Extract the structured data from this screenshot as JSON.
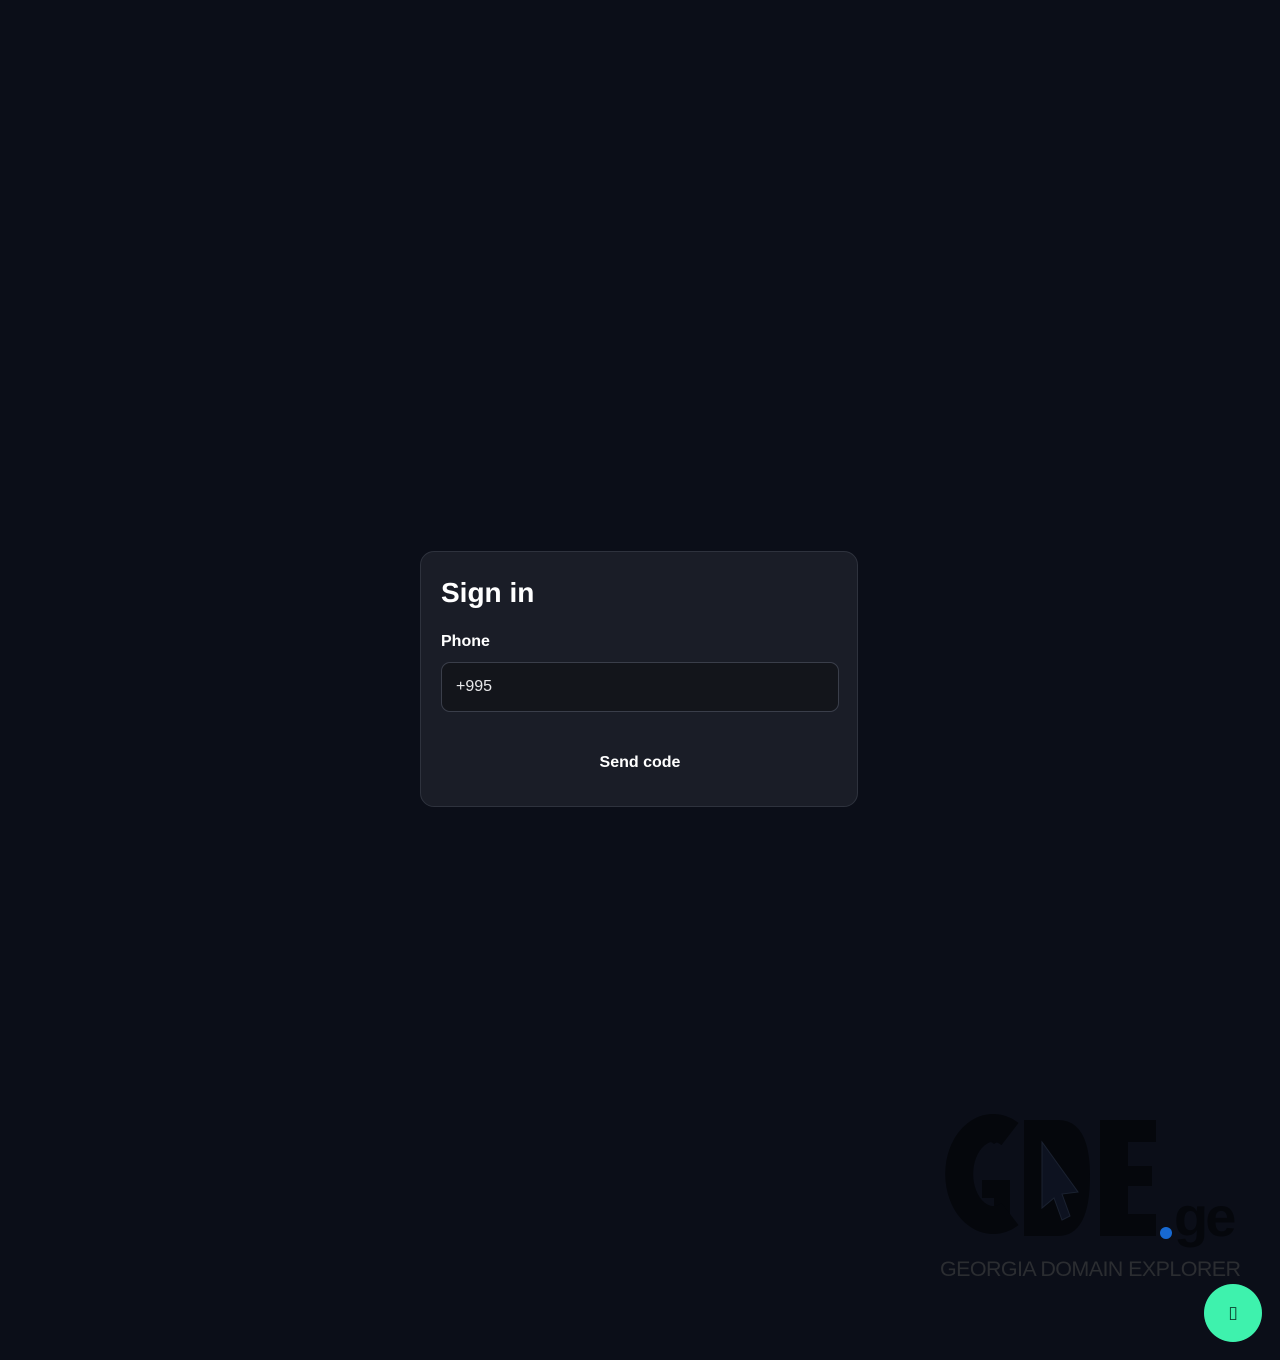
{
  "signin": {
    "title": "Sign in",
    "phone_label": "Phone",
    "phone_value": "+995",
    "send_button": "Send code"
  },
  "logo": {
    "wordmark": "GDE",
    "tld": ".ge",
    "tagline": "GEORGIA DOMAIN EXPLORER"
  },
  "fab": {
    "glyph": "▯",
    "icon": "chat-icon"
  },
  "colors": {
    "background": "#0b0e18",
    "card": "#1a1d27",
    "fab": "#3ef2ad",
    "logo_dot": "#1769d2"
  }
}
